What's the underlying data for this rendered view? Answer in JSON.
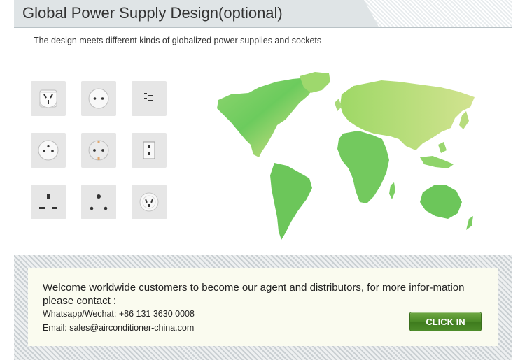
{
  "header": {
    "title": "Global Power Supply Design(optional)"
  },
  "subtitle": "The design meets different kinds of globalized power supplies and sockets",
  "sockets": [
    {
      "icon": "australian-plug-icon"
    },
    {
      "icon": "europlug-round-icon"
    },
    {
      "icon": "flat-pin-socket-icon"
    },
    {
      "icon": "three-round-pin-socket-icon"
    },
    {
      "icon": "schuko-socket-icon"
    },
    {
      "icon": "vertical-slot-socket-icon"
    },
    {
      "icon": "uk-bs1363-socket-icon"
    },
    {
      "icon": "south-african-socket-icon"
    },
    {
      "icon": "swiss-socket-icon"
    }
  ],
  "map": {
    "icon": "world-map-icon",
    "color": "#6cc65a"
  },
  "contact": {
    "welcome": "Welcome worldwide customers to become our agent and distributors, for more infor-mation please contact :",
    "whatsapp": "Whatsapp/Wechat: +86 131 3630 0008",
    "email": "Email: sales@airconditioner-china.com",
    "button_label": "CLICK IN"
  },
  "colors": {
    "accent": "#4b8a27",
    "header_bg": "#dfe4e6",
    "panel_bg": "#fafbef"
  }
}
